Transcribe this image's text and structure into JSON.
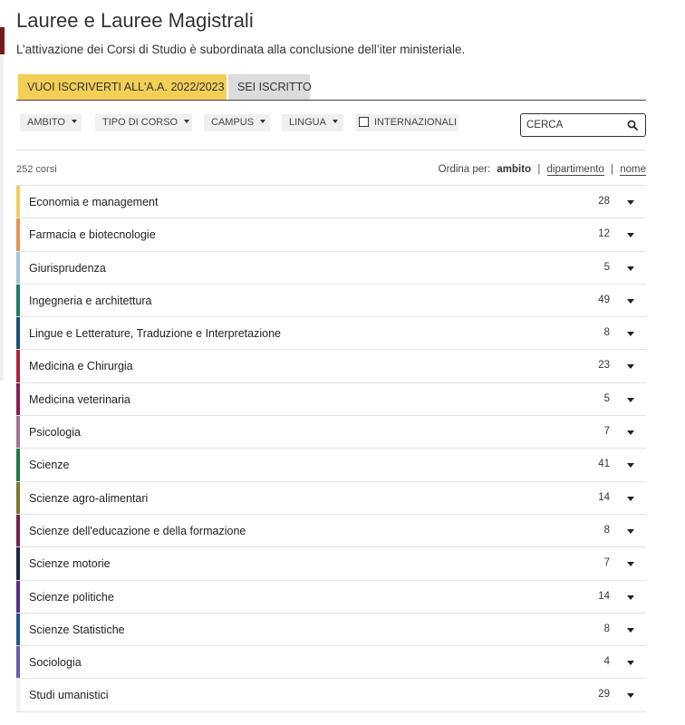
{
  "header": {
    "title": "Lauree e Lauree Magistrali",
    "subtitle": "L’attivazione dei Corsi di Studio è subordinata alla conclusione dell’iter ministeriale."
  },
  "tabs": [
    {
      "label": "VUOI ISCRIVERTI ALL'A.A. 2022/2023",
      "active": true
    },
    {
      "label": "SEI ISCRITTO",
      "active": false
    }
  ],
  "filters": {
    "ambito": "AMBITO",
    "tipo": "TIPO DI CORSO",
    "campus": "CAMPUS",
    "lingua": "LINGUA",
    "internazionali": "INTERNAZIONALI"
  },
  "search": {
    "placeholder": "CERCA"
  },
  "results": {
    "count": "252 corsi"
  },
  "sort": {
    "label": "Ordina per:",
    "options": [
      "ambito",
      "dipartimento",
      "nome"
    ],
    "active": "ambito"
  },
  "areas": [
    {
      "name": "Economia e management",
      "count": "28",
      "color": "#f4cf56"
    },
    {
      "name": "Farmacia e biotecnologie",
      "count": "12",
      "color": "#e8924b"
    },
    {
      "name": "Giurisprudenza",
      "count": "5",
      "color": "#9ec7e3"
    },
    {
      "name": "Ingegneria e architettura",
      "count": "49",
      "color": "#1f7a6a"
    },
    {
      "name": "Lingue e Letterature, Traduzione e Interpretazione",
      "count": "8",
      "color": "#1a4f7a"
    },
    {
      "name": "Medicina e Chirurgia",
      "count": "23",
      "color": "#b5223a"
    },
    {
      "name": "Medicina veterinaria",
      "count": "5",
      "color": "#8c1a5a"
    },
    {
      "name": "Psicologia",
      "count": "7",
      "color": "#a8708e"
    },
    {
      "name": "Scienze",
      "count": "41",
      "color": "#1e7a44"
    },
    {
      "name": "Scienze agro-alimentari",
      "count": "14",
      "color": "#7a7a2a"
    },
    {
      "name": "Scienze dell'educazione e della formazione",
      "count": "8",
      "color": "#7a1e4a"
    },
    {
      "name": "Scienze motorie",
      "count": "7",
      "color": "#1a2a44"
    },
    {
      "name": "Scienze politiche",
      "count": "14",
      "color": "#5a2a8c"
    },
    {
      "name": "Scienze Statistiche",
      "count": "8",
      "color": "#1a5a8c"
    },
    {
      "name": "Sociologia",
      "count": "4",
      "color": "#6a5ab0"
    },
    {
      "name": "Studi umanistici",
      "count": "29",
      "color": "#f2f2f2"
    }
  ]
}
